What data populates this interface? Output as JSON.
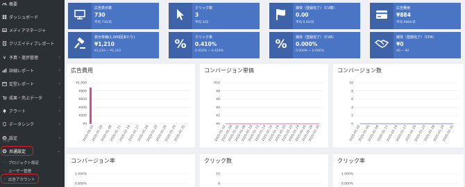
{
  "sidebar": {
    "items": [
      {
        "label": "概要",
        "icon": "gauge-icon",
        "chevron": ""
      },
      {
        "label": "ダッシュボード",
        "icon": "grid-icon",
        "chevron": ""
      },
      {
        "label": "メディアマネージャ",
        "icon": "image-icon",
        "chevron": ""
      },
      {
        "label": "クリエイティブレポート",
        "icon": "document-icon",
        "chevron": ""
      },
      {
        "label": "予算・進捗管理",
        "icon": "yen-icon",
        "chevron": "‹"
      },
      {
        "label": "詳細レポート",
        "icon": "report-icon",
        "chevron": "‹"
      },
      {
        "label": "定型レポート",
        "icon": "calendar-icon",
        "chevron": "‹"
      },
      {
        "label": "成果・売上データ",
        "icon": "cart-icon",
        "chevron": "‹"
      },
      {
        "label": "アラート",
        "icon": "bell-icon",
        "chevron": "‹"
      },
      {
        "label": "データシンク",
        "icon": "sync-icon",
        "chevron": "‹"
      },
      {
        "label": "設定",
        "icon": "gear-icon",
        "chevron": "‹"
      }
    ],
    "section_label": "共通",
    "common_settings": {
      "label": "共通設定",
      "chevron": "⌄"
    },
    "sub_items": [
      {
        "label": "プロジェクト設定"
      },
      {
        "label": "ユーザー管理"
      },
      {
        "label": "広告アカウント"
      }
    ]
  },
  "kpis": [
    {
      "label": "広告表示数",
      "value": "730",
      "sub": "平均 730/日",
      "icon": "monitor-icon"
    },
    {
      "label": "クリック数",
      "value": "3",
      "sub": "平均 3/日",
      "icon": "cursor-icon"
    },
    {
      "label": "媒体（登録完了）（CV数）",
      "value": "0.00",
      "sub": "平均 0.00/日",
      "icon": "flag-icon"
    },
    {
      "label": "広告費用",
      "value": "¥884",
      "sub": "平均 ¥884/日",
      "icon": "credit-card-icon"
    },
    {
      "label": "表示単価(1,000回あたり)",
      "value": "¥1,210",
      "sub": "¥1,210 ~ ¥1,210",
      "icon": "gavel-icon"
    },
    {
      "label": "クリック率",
      "value": "0.410%",
      "sub": "0.410% ~ 0.410%",
      "icon": "percent-icon"
    },
    {
      "label": "媒体（登録完了）（CVR）",
      "value": "0.000%",
      "sub": "0.000% ~ 0.000%",
      "icon": "percent-icon"
    },
    {
      "label": "媒体（登録完了）（CPA）",
      "value": "¥0",
      "sub": "¥0 ~ ¥0",
      "icon": "handshake-icon"
    }
  ],
  "chart_data": [
    {
      "type": "bar",
      "title": "広告費用",
      "categories": [
        "2025-01-02",
        "2025-01-05",
        "2025-01-08",
        "2025-01-11",
        "2025-01-14",
        "2025-01-17",
        "2025-01-20",
        "2025-01-23",
        "2025-01-26",
        "2025-01-29",
        "2025-01-31"
      ],
      "values": [
        884,
        0,
        0,
        0,
        0,
        0,
        0,
        0,
        0,
        0,
        0
      ],
      "yticks": [
        "¥1,000",
        "¥800",
        "¥600",
        "¥400",
        "¥200",
        "¥0"
      ],
      "ylim": [
        0,
        1000
      ],
      "color": "#d9468f"
    },
    {
      "type": "line",
      "title": "コンバージョン単価",
      "categories": [
        "2025-01-02",
        "2025-01-04",
        "2025-01-06",
        "2025-01-08",
        "2025-01-10",
        "2025-01-12",
        "2025-01-14",
        "2025-01-16",
        "2025-01-18",
        "2025-01-20",
        "2025-01-22",
        "2025-01-24",
        "2025-01-26",
        "2025-01-28",
        "2025-01-30"
      ],
      "values": [
        0,
        0,
        0,
        0,
        0,
        0,
        0,
        0,
        0,
        0,
        0,
        0,
        0,
        0,
        0
      ],
      "yticks": [
        "¥10",
        "¥8",
        "¥6",
        "¥4",
        "¥2",
        "¥0"
      ],
      "ylim": [
        0,
        10
      ],
      "color": "#d9468f"
    },
    {
      "type": "line",
      "title": "コンバージョン数",
      "categories": [
        "2025-01-02",
        "2025-01-05",
        "2025-01-08",
        "2025-01-11",
        "2025-01-14",
        "2025-01-17",
        "2025-01-20",
        "2025-01-23",
        "2025-01-26",
        "2025-01-29",
        "2025-01-31"
      ],
      "values": [
        0,
        0,
        0,
        0,
        0,
        0,
        0,
        0,
        0,
        0,
        0
      ],
      "yticks": [
        "10",
        "8",
        "6",
        "4",
        "2",
        "0"
      ],
      "ylim": [
        0,
        10
      ],
      "color": "#4a74c4"
    },
    {
      "type": "line",
      "title": "コンバージョン率",
      "yticks": [
        "1.000%",
        "0.800%"
      ]
    },
    {
      "type": "line",
      "title": "クリック数",
      "yticks": [
        "10",
        "8"
      ]
    },
    {
      "type": "line",
      "title": "クリック率",
      "yticks": [
        "1.000%",
        "0.800%"
      ]
    }
  ]
}
